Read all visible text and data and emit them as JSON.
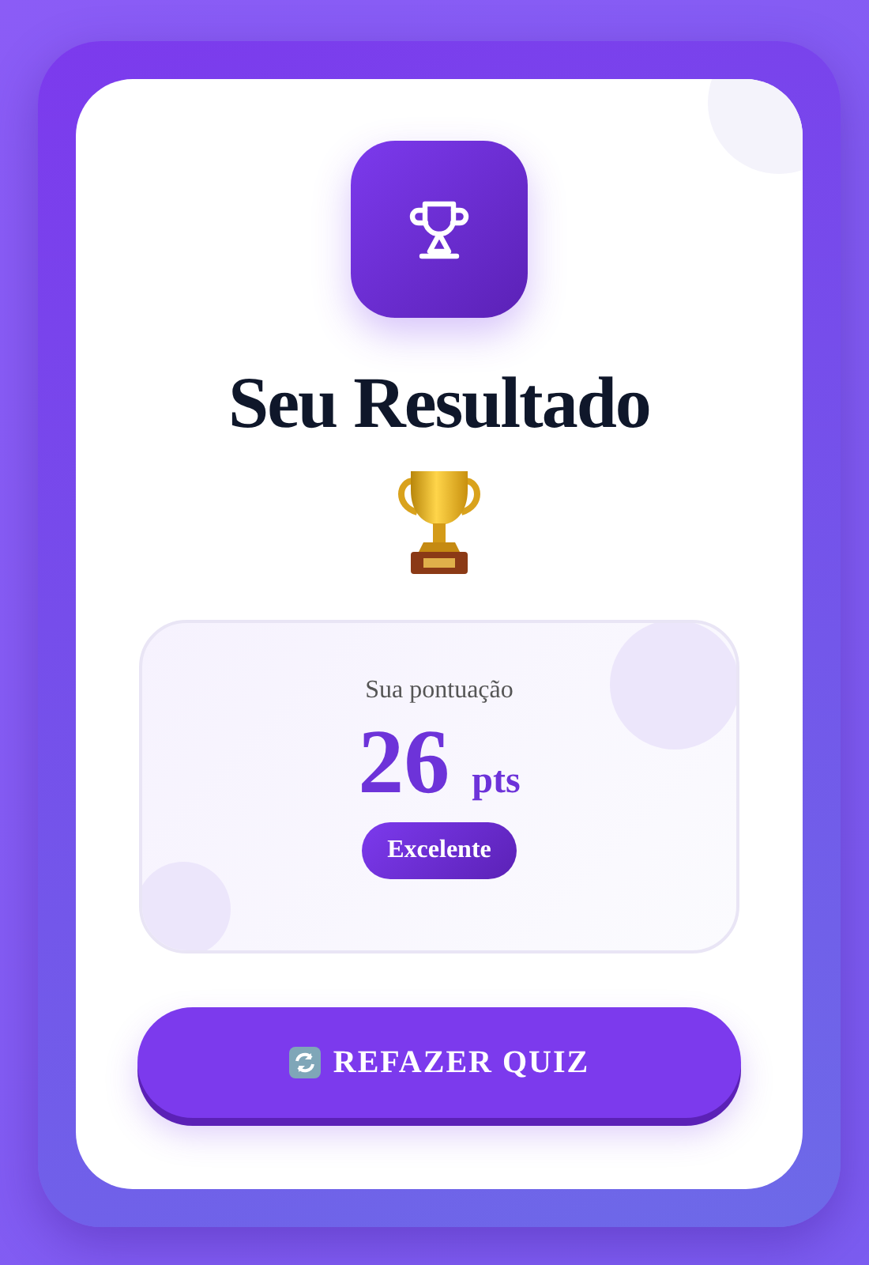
{
  "title": "Seu Resultado",
  "score": {
    "label": "Sua pontuação",
    "value": "26",
    "unit": "pts",
    "rating": "Excelente"
  },
  "button": {
    "label": "REFAZER QUIZ"
  }
}
